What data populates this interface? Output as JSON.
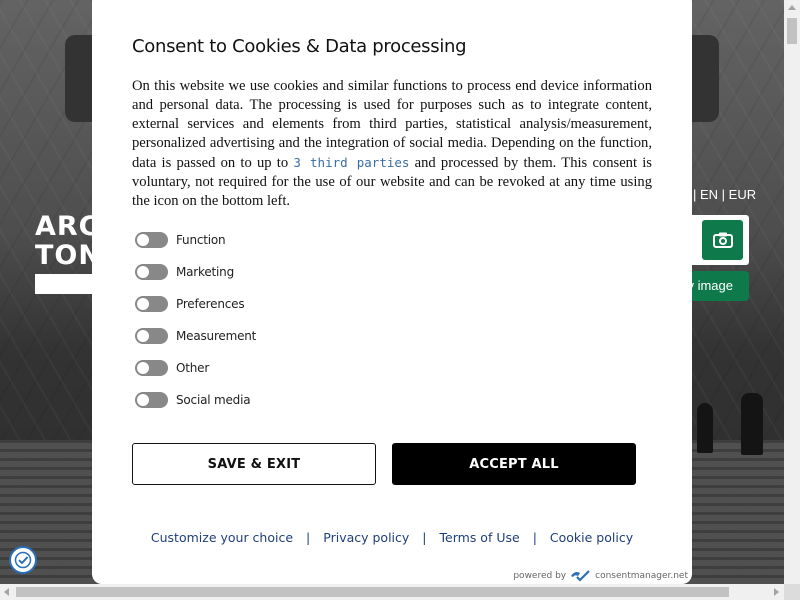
{
  "background": {
    "logo_line1": "ARCI",
    "logo_line2": "TONI",
    "lang_switch": "| EN | EUR",
    "search_image_label": "y image"
  },
  "consent": {
    "title": "Consent to Cookies & Data processing",
    "body_part1": "On this website we use cookies and similar functions to process end device information and personal data. The processing is used for purposes such as to integrate content, external services and elements from third parties, statistical analysis/measurement, personalized advertising and the integration of social media. Depending on the function, data is passed on to up to ",
    "third_parties_link": "3 third parties",
    "body_part2": " and processed by them. This consent is voluntary, not required for the use of our website and can be revoked at any time using the icon on the bottom left.",
    "toggles": [
      {
        "label": "Function",
        "enabled": false
      },
      {
        "label": "Marketing",
        "enabled": false
      },
      {
        "label": "Preferences",
        "enabled": false
      },
      {
        "label": "Measurement",
        "enabled": false
      },
      {
        "label": "Other",
        "enabled": false
      },
      {
        "label": "Social media",
        "enabled": false
      }
    ],
    "save_exit_label": "SAVE & EXIT",
    "accept_all_label": "ACCEPT ALL",
    "links": {
      "customize": "Customize your choice",
      "privacy": "Privacy policy",
      "terms": "Terms of Use",
      "cookie": "Cookie policy",
      "separator": "|"
    },
    "powered_by": "powered by",
    "provider": "consentmanager.net"
  },
  "colors": {
    "accent_green": "#0e7a4b",
    "link_blue": "#1e3f7a",
    "toggle_off": "#888888",
    "accept_bg": "#000000"
  },
  "icons": {
    "camera": "camera-icon",
    "consent": "consent-shield-icon",
    "provider_logo": "consentmanager-logo-icon"
  }
}
